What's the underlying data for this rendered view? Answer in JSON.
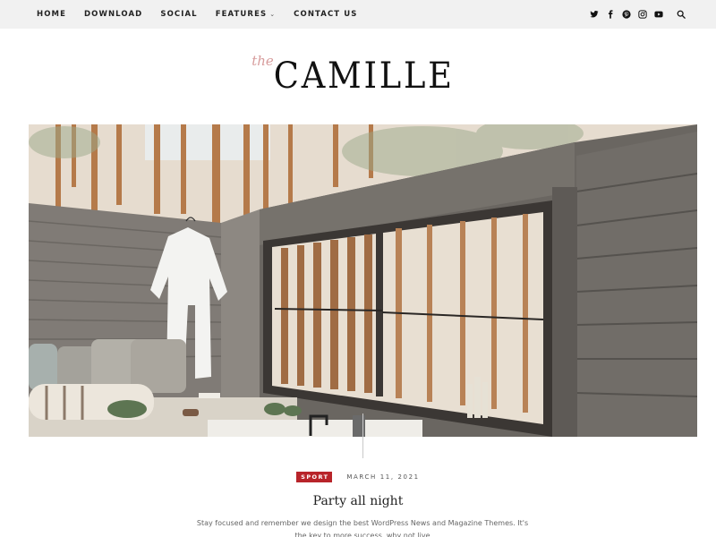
{
  "nav": {
    "items": [
      {
        "label": "HOME"
      },
      {
        "label": "DOWNLOAD"
      },
      {
        "label": "SOCIAL"
      },
      {
        "label": "FEATURES",
        "has_dropdown": true
      },
      {
        "label": "CONTACT US"
      }
    ],
    "dropdown_glyph": "⌄"
  },
  "social": {
    "icons": [
      "twitter-icon",
      "facebook-icon",
      "pinterest-icon",
      "instagram-icon",
      "youtube-icon"
    ],
    "search_icon": "search-icon"
  },
  "logo": {
    "prefix": "the",
    "name": "CAMILLE",
    "prefix_color": "#d79c9c"
  },
  "featured_post": {
    "image_alt": "Outdoor bath area with gray wood-panel walls, white robe hanging, cushioned bench and wooden window slats overlooking a forest",
    "category": "SPORT",
    "category_color": "#b8242a",
    "date": "MARCH 11, 2021",
    "title": "Party all night",
    "excerpt": "Stay focused and remember we design the best WordPress News and Magazine Themes. It's the key to more success, why not live"
  }
}
